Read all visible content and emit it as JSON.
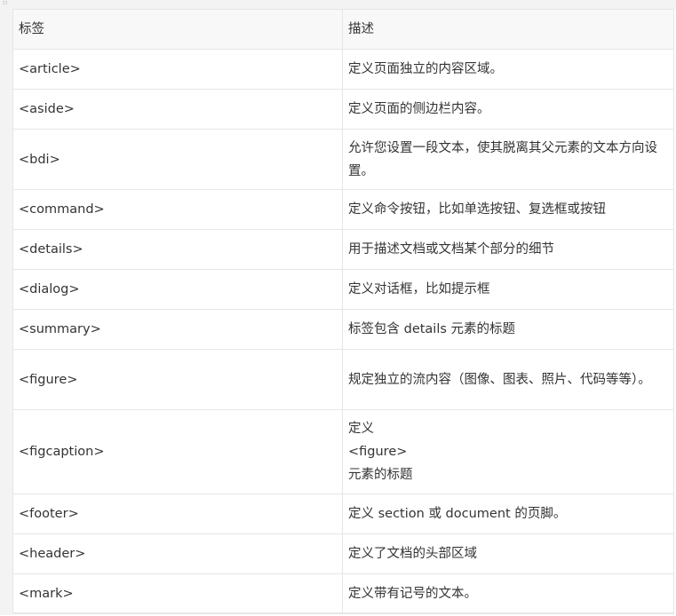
{
  "table": {
    "headers": [
      "标签",
      "描述"
    ],
    "rows": [
      {
        "tag": "<article>",
        "desc": [
          "定义页面独立的内容区域。"
        ]
      },
      {
        "tag": "<aside>",
        "desc": [
          "定义页面的侧边栏内容。"
        ]
      },
      {
        "tag": "<bdi>",
        "desc": [
          "允许您设置一段文本，使其脱离其父元素的文本方向设置。"
        ]
      },
      {
        "tag": "<command>",
        "desc": [
          "定义命令按钮，比如单选按钮、复选框或按钮"
        ]
      },
      {
        "tag": "<details>",
        "desc": [
          "用于描述文档或文档某个部分的细节"
        ]
      },
      {
        "tag": "<dialog>",
        "desc": [
          "定义对话框，比如提示框"
        ]
      },
      {
        "tag": "<summary>",
        "desc": [
          "标签包含 details 元素的标题"
        ]
      },
      {
        "tag": "<figure>",
        "desc": [
          "规定独立的流内容（图像、图表、照片、代码等等）。"
        ]
      },
      {
        "tag": "<figcaption>",
        "desc": [
          "定义",
          "<figure>",
          "元素的标题"
        ]
      },
      {
        "tag": "<footer>",
        "desc": [
          "定义 section 或 document 的页脚。"
        ]
      },
      {
        "tag": "<header>",
        "desc": [
          "定义了文档的头部区域"
        ]
      },
      {
        "tag": "<mark>",
        "desc": [
          "定义带有记号的文本。"
        ]
      }
    ]
  }
}
